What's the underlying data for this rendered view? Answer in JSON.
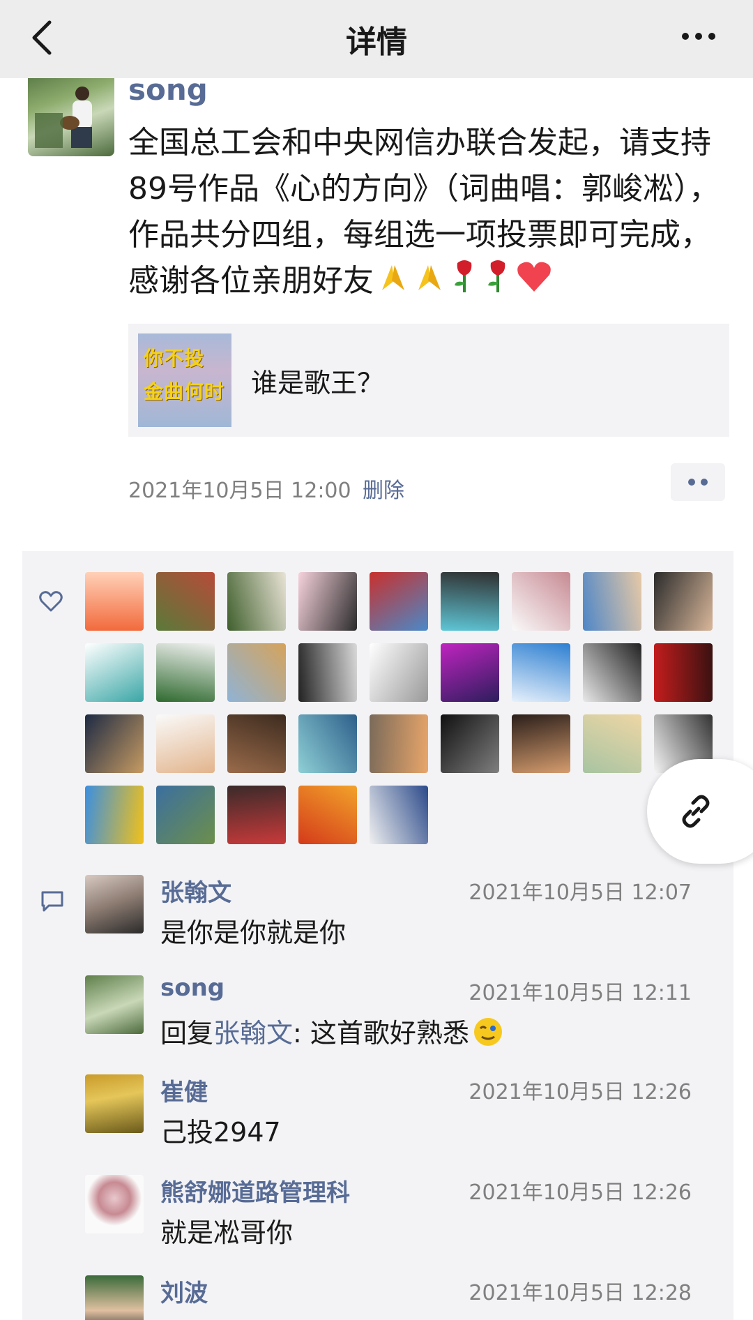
{
  "header": {
    "title": "详情"
  },
  "post": {
    "author": "song",
    "text": "全国总工会和中央网信办联合发起，请支持89号作品《心的方向》（词曲唱：郭峻凇），作品共分四组，每组选一项投票即可完成，感谢各位亲朋好友",
    "emojis": [
      "pray-emoji",
      "pray-emoji",
      "rose-emoji",
      "rose-emoji",
      "heart-emoji"
    ],
    "link": {
      "thumb_line1": "你不投",
      "thumb_line2": "金曲何时",
      "title": "谁是歌王？"
    },
    "timestamp": "2021年10月5日 12:00",
    "delete_label": "删除"
  },
  "likes": {
    "avatars": [
      {
        "c1": "#f26a3c",
        "c2": "#ffd1b8"
      },
      {
        "c1": "#5a7a3a",
        "c2": "#b74b3a"
      },
      {
        "c1": "#3f5f2c",
        "c2": "#e9e3d6"
      },
      {
        "c1": "#f6d2dc",
        "c2": "#2b2b2b"
      },
      {
        "c1": "#c9302c",
        "c2": "#4a89c8"
      },
      {
        "c1": "#5ec6d6",
        "c2": "#2f2f2f"
      },
      {
        "c1": "#fafafa",
        "c2": "#c78a93"
      },
      {
        "c1": "#4d86c7",
        "c2": "#e7c9a6"
      },
      {
        "c1": "#2b2b2b",
        "c2": "#d9b79a"
      },
      {
        "c1": "#ffffff",
        "c2": "#3aa6a6"
      },
      {
        "c1": "#2f6a2f",
        "c2": "#f2f2f2"
      },
      {
        "c1": "#8fb3d6",
        "c2": "#d6a35b"
      },
      {
        "c1": "#222222",
        "c2": "#d9d9d9"
      },
      {
        "c1": "#ffffff",
        "c2": "#999999"
      },
      {
        "c1": "#c024c0",
        "c2": "#2c1d5c"
      },
      {
        "c1": "#e6f0fb",
        "c2": "#2d7fd1"
      },
      {
        "c1": "#e9e9e9",
        "c2": "#222222"
      },
      {
        "c1": "#c41d1d",
        "c2": "#3a1111"
      },
      {
        "c1": "#1d2a44",
        "c2": "#c79b62"
      },
      {
        "c1": "#fafafa",
        "c2": "#e2b48c"
      },
      {
        "c1": "#9a6b4a",
        "c2": "#3d2b1f"
      },
      {
        "c1": "#8fd0d6",
        "c2": "#2d5f8a"
      },
      {
        "c1": "#7a6a5a",
        "c2": "#e9a66a"
      },
      {
        "c1": "#101010",
        "c2": "#7f7f7f"
      },
      {
        "c1": "#2a1e1a",
        "c2": "#d59c6e"
      },
      {
        "c1": "#a7c4a2",
        "c2": "#eed6a5"
      },
      {
        "c1": "#f5f5f5",
        "c2": "#333333"
      },
      {
        "c1": "#3b8fe0",
        "c2": "#f2c11a"
      },
      {
        "c1": "#3b6fa0",
        "c2": "#6d8f4a"
      },
      {
        "c1": "#3a2a2a",
        "c2": "#c93a3a"
      },
      {
        "c1": "#d43a1a",
        "c2": "#f2a32a"
      },
      {
        "c1": "#f0f0f0",
        "c2": "#2b4a8a"
      }
    ]
  },
  "comments": [
    {
      "name": "张翰文",
      "time": "2021年10月5日 12:07",
      "text": "是你是你就是你",
      "avatar_c1": "#d8c9c2",
      "avatar_c2": "#2a2a2a"
    },
    {
      "name": "song",
      "time": "2021年10月5日 12:11",
      "reply_prefix": "回复",
      "reply_to": "张翰文",
      "reply_text": ": 这首歌好熟悉",
      "avatar_c1": "#5f7f4b",
      "avatar_c2": "#c9d8b8"
    },
    {
      "name": "崔健",
      "time": "2021年10月5日 12:26",
      "text": "己投2947",
      "avatar_c1": "#c99b2a",
      "avatar_c2": "#6a5a1a"
    },
    {
      "name": "熊舒娜道路管理科",
      "time": "2021年10月5日 12:26",
      "text": "就是凇哥你",
      "avatar_c1": "#fafafa",
      "avatar_c2": "#c78a93"
    },
    {
      "name": "刘波",
      "time": "2021年10月5日 12:28",
      "text": "",
      "avatar_c1": "#3a6a3a",
      "avatar_c2": "#e0c0a0"
    }
  ]
}
